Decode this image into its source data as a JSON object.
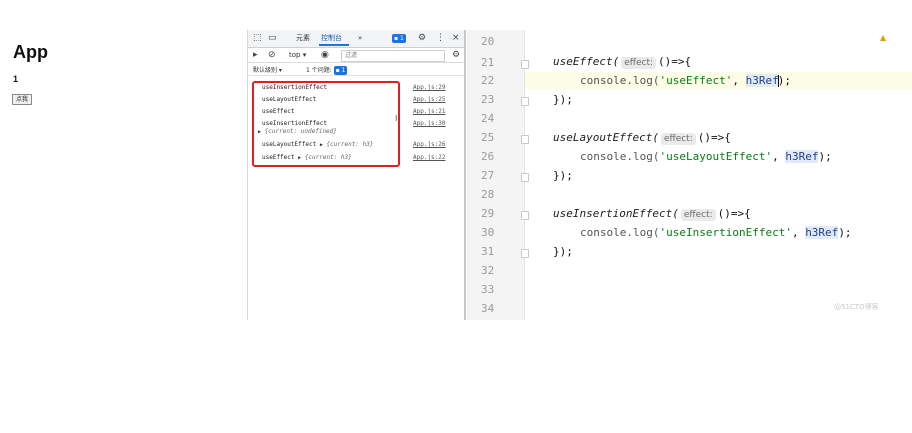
{
  "app": {
    "title": "App",
    "count": "1",
    "button_label": "点我"
  },
  "devtools": {
    "tabs": [
      "元素",
      "控制台",
      "»"
    ],
    "issues_badge": "1",
    "context": "top ▾",
    "filter_placeholder": "过滤",
    "levels": "默认级别 ▾",
    "issues_count": "1 个问题:",
    "issues_count_badge": "1",
    "console_rows": [
      {
        "text": "useInsertionEffect",
        "source": "App.js:29",
        "obj": ""
      },
      {
        "text": "useLayoutEffect",
        "source": "App.js:25",
        "obj": ""
      },
      {
        "text": "useEffect",
        "source": "App.js:21",
        "obj": ""
      },
      {
        "text": "useInsertionEffect",
        "source": "App.js:30",
        "obj": "{current: undefined}"
      },
      {
        "text": "useLayoutEffect",
        "source": "App.js:26",
        "obj": "{current: h3}"
      },
      {
        "text": "useEffect",
        "source": "App.js:22",
        "obj": "{current: h3}"
      }
    ]
  },
  "editor": {
    "line_numbers": [
      "20",
      "21",
      "22",
      "23",
      "24",
      "25",
      "26",
      "27",
      "28",
      "29",
      "30",
      "31",
      "32",
      "33",
      "34"
    ],
    "hint_label": "effect:",
    "blocks": [
      {
        "fn": "useEffect(",
        "rest": "()=>{",
        "log": "console.log(",
        "str": "'useEffect'",
        "ref": "h3Ref",
        "end": ");",
        "close": "});"
      },
      {
        "fn": "useLayoutEffect(",
        "rest": "()=>{",
        "log": "console.log(",
        "str": "'useLayoutEffect'",
        "ref": "h3Ref",
        "end": ");",
        "close": "});"
      },
      {
        "fn": "useInsertionEffect(",
        "rest": "()=>{",
        "log": "console.log(",
        "str": "'useInsertionEffect'",
        "ref": "h3Ref",
        "end": ");",
        "close": "});"
      }
    ],
    "watermark": "@51CTO博客"
  }
}
